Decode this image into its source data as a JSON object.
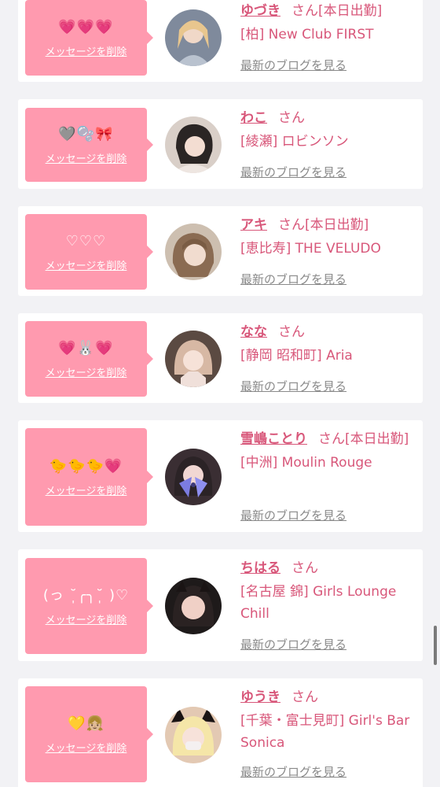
{
  "ui": {
    "delete_label": "メッセージを削除",
    "blog_label": "最新のブログを見る",
    "san": "さん"
  },
  "colors": {
    "accent": "#d8577a",
    "bubble": "#ff9aaf",
    "link_gray": "#8a8a8a",
    "background": "#f2f2f5"
  },
  "entries": [
    {
      "message": "💗💗💗",
      "name": "ゆづき",
      "status": "[本日出勤]",
      "shop": "[柏] New Club FIRST"
    },
    {
      "message": "🩶🫧🎀",
      "name": "わこ",
      "status": "",
      "shop": "[綾瀬] ロビンソン"
    },
    {
      "message": "♡♡♡",
      "name": "アキ",
      "status": "[本日出勤]",
      "shop": "[恵比寿] THE VELUDO"
    },
    {
      "message": "💗🐰💗",
      "name": "なな",
      "status": "",
      "shop": "[静岡 昭和町] Aria"
    },
    {
      "message": "🐤🐤🐤💗",
      "name": "雪嶋ことり",
      "status": "[本日出勤]",
      "shop": "[中洲] Moulin Rouge"
    },
    {
      "message": "(っ ˘̩╭╮˘̩ )♡",
      "name": "ちはる",
      "status": "",
      "shop": "[名古屋 錦] Girls Lounge Chill"
    },
    {
      "message": "💛👧🏼",
      "name": "ゆうき",
      "status": "",
      "shop": "[千葉・富士見町] Girl's Bar Sonica"
    }
  ]
}
